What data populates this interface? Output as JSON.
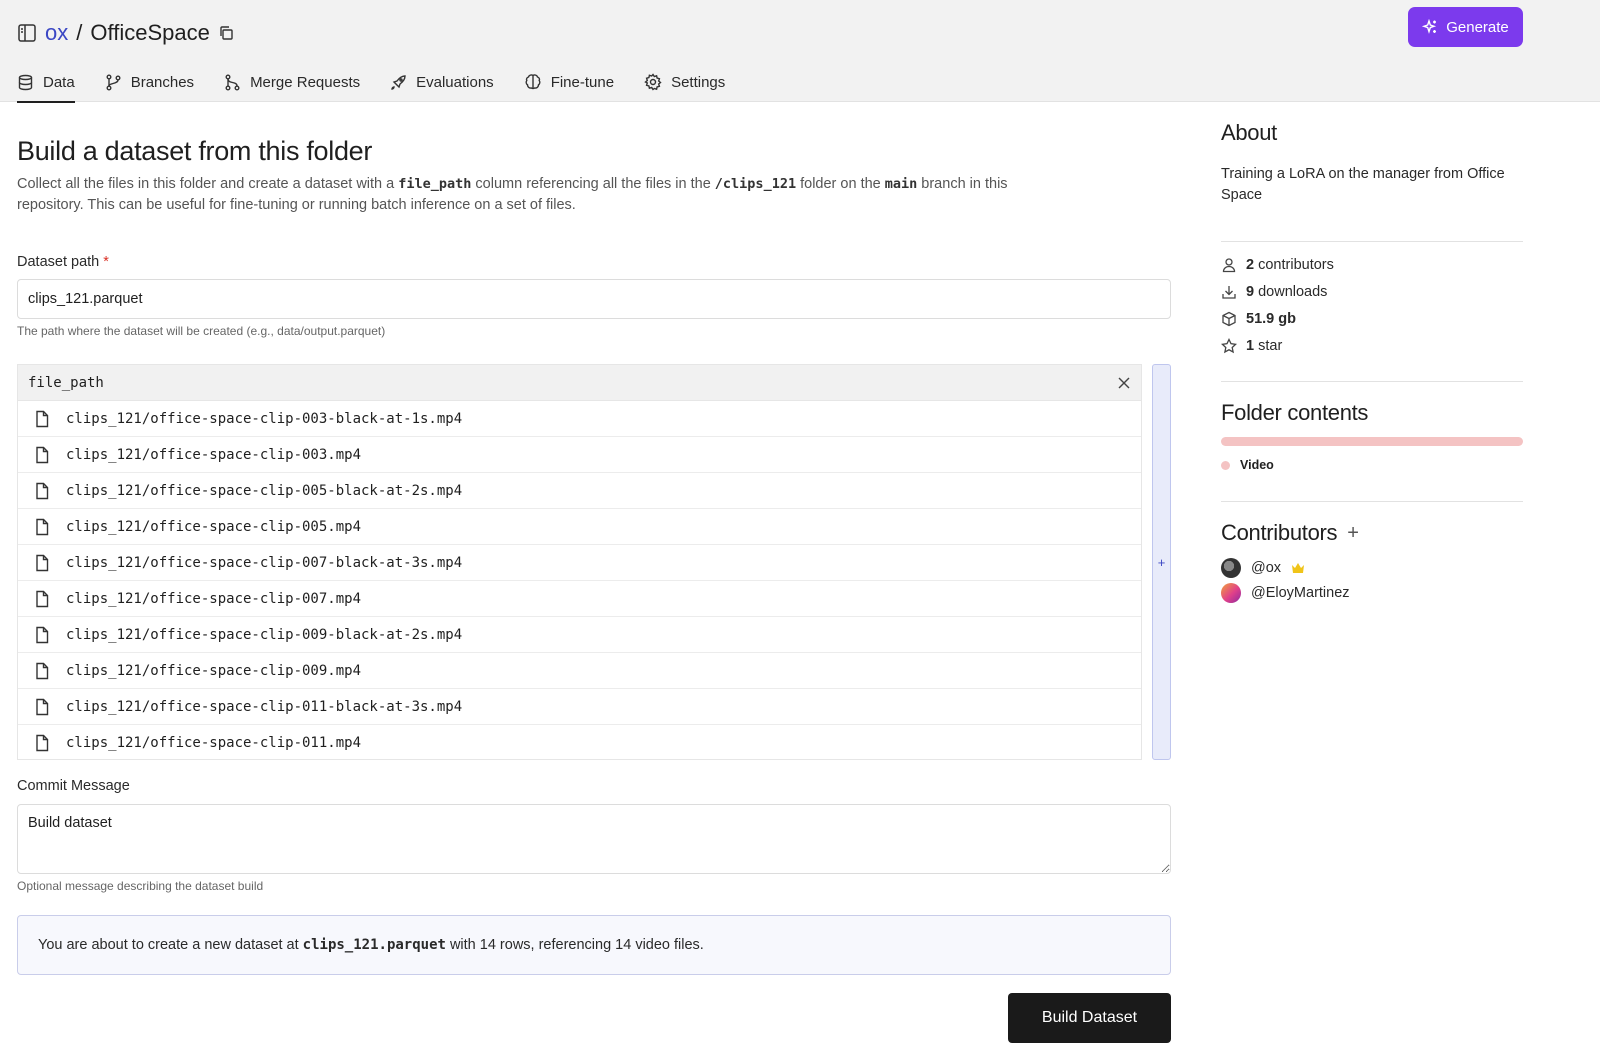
{
  "header": {
    "owner": "ox",
    "separator": "/",
    "repo": "OfficeSpace",
    "generate_label": "Generate"
  },
  "tabs": [
    {
      "label": "Data",
      "icon": "database-icon",
      "active": true
    },
    {
      "label": "Branches",
      "icon": "branch-icon",
      "active": false
    },
    {
      "label": "Merge Requests",
      "icon": "merge-icon",
      "active": false
    },
    {
      "label": "Evaluations",
      "icon": "rocket-icon",
      "active": false
    },
    {
      "label": "Fine-tune",
      "icon": "brain-icon",
      "active": false
    },
    {
      "label": "Settings",
      "icon": "gear-icon",
      "active": false
    }
  ],
  "main": {
    "title": "Build a dataset from this folder",
    "desc_parts": {
      "p1": "Collect all the files in this folder and create a dataset with a ",
      "code1": "file_path",
      "p2": " column referencing all the files in the ",
      "code2": "/clips_121",
      "p3": " folder on the ",
      "code3": "main",
      "p4": " branch in this repository. This can be useful for fine-tuning or running batch inference on a set of files."
    },
    "dataset_path_label": "Dataset path",
    "required_mark": "*",
    "dataset_path_value": "clips_121.parquet",
    "dataset_path_hint": "The path where the dataset will be created (e.g., data/output.parquet)",
    "table": {
      "column": "file_path",
      "rows": [
        "clips_121/office-space-clip-003-black-at-1s.mp4",
        "clips_121/office-space-clip-003.mp4",
        "clips_121/office-space-clip-005-black-at-2s.mp4",
        "clips_121/office-space-clip-005.mp4",
        "clips_121/office-space-clip-007-black-at-3s.mp4",
        "clips_121/office-space-clip-007.mp4",
        "clips_121/office-space-clip-009-black-at-2s.mp4",
        "clips_121/office-space-clip-009.mp4",
        "clips_121/office-space-clip-011-black-at-3s.mp4",
        "clips_121/office-space-clip-011.mp4"
      ],
      "add_column_label": "+"
    },
    "commit_label": "Commit Message",
    "commit_value": "Build dataset",
    "commit_hint": "Optional message describing the dataset build",
    "info": {
      "p1": "You are about to create a new dataset at",
      "code": "clips_121.parquet",
      "p2": "with 14 rows, referencing 14 video files."
    },
    "build_label": "Build Dataset"
  },
  "sidebar": {
    "about_title": "About",
    "about_text": "Training a LoRA on the manager from Office Space",
    "stats": [
      {
        "icon": "user-icon",
        "value": "2",
        "label": " contributors"
      },
      {
        "icon": "download-icon",
        "value": "9",
        "label": " downloads"
      },
      {
        "icon": "box-icon",
        "value": "51.9 gb",
        "label": ""
      },
      {
        "icon": "star-icon",
        "value": "1",
        "label": " star"
      }
    ],
    "folder_title": "Folder contents",
    "folder_legend": "Video",
    "contributors_title": "Contributors",
    "contributors_add": "+",
    "contributors": [
      {
        "name": "@ox",
        "crown": true
      },
      {
        "name": "@EloyMartinez",
        "crown": false
      }
    ]
  },
  "colors": {
    "accent": "#7c3aed",
    "link": "#3b47c4",
    "video": "#f4c3c3",
    "crown": "#f0c419"
  }
}
